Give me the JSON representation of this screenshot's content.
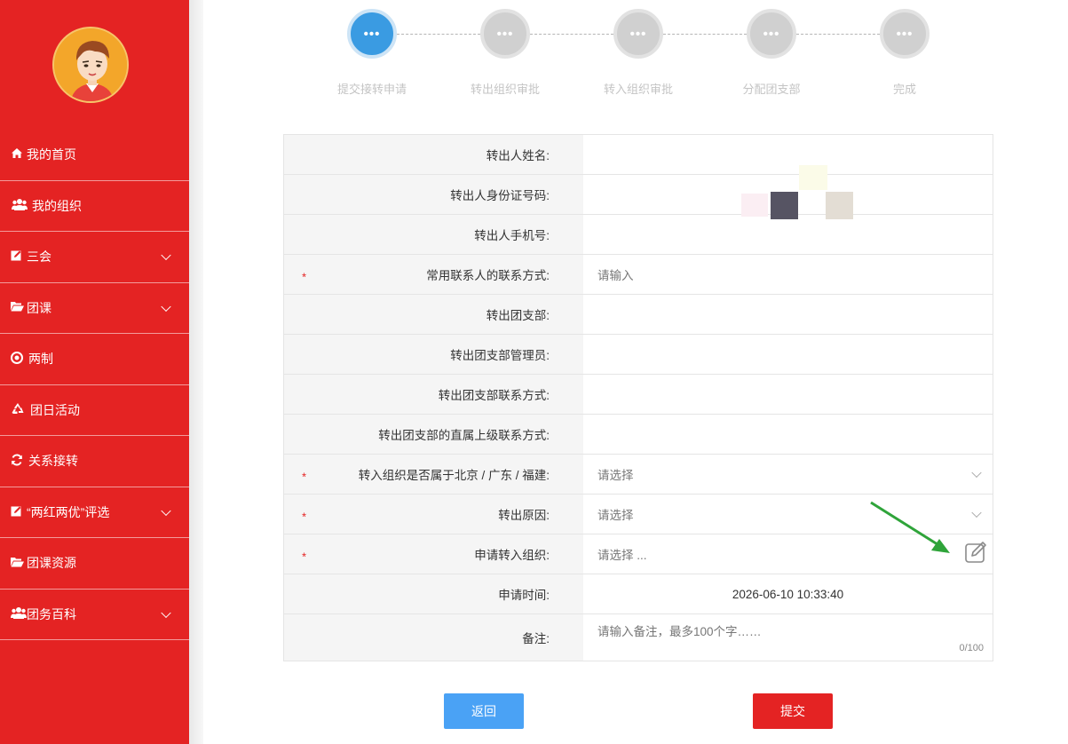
{
  "sidebar": {
    "items": [
      {
        "icon": "home-icon",
        "label": "我的首页",
        "has_submenu": false
      },
      {
        "icon": "users-icon",
        "label": "我的组织",
        "has_submenu": false
      },
      {
        "icon": "edit-icon",
        "label": "三会",
        "has_submenu": true
      },
      {
        "icon": "folder-icon",
        "label": "团课",
        "has_submenu": true
      },
      {
        "icon": "target-icon",
        "label": "两制",
        "has_submenu": false
      },
      {
        "icon": "recycle-icon",
        "label": "团日活动",
        "has_submenu": false
      },
      {
        "icon": "refresh-icon",
        "label": "关系接转",
        "has_submenu": false
      },
      {
        "icon": "edit-icon",
        "label": "“两红两优”评选",
        "has_submenu": true
      },
      {
        "icon": "folder-icon",
        "label": "团课资源",
        "has_submenu": false
      },
      {
        "icon": "users-icon",
        "label": "团务百科",
        "has_submenu": true
      }
    ]
  },
  "steps": [
    {
      "label": "提交接转申请",
      "dots": "•••",
      "active": true
    },
    {
      "label": "转出组织审批",
      "dots": "•••",
      "active": false
    },
    {
      "label": "转入组织审批",
      "dots": "•••",
      "active": false
    },
    {
      "label": "分配团支部",
      "dots": "•••",
      "active": false
    },
    {
      "label": "完成",
      "dots": "•••",
      "active": false
    }
  ],
  "form": {
    "rows": [
      {
        "label": "转出人姓名:",
        "required": false,
        "value": "",
        "kind": "text"
      },
      {
        "label": "转出人身份证号码:",
        "required": false,
        "value": "",
        "kind": "text"
      },
      {
        "label": "转出人手机号:",
        "required": false,
        "value": "",
        "kind": "text"
      },
      {
        "label": "常用联系人的联系方式:",
        "required": true,
        "value": "请输入",
        "kind": "input"
      },
      {
        "label": "转出团支部:",
        "required": false,
        "value": "",
        "kind": "text"
      },
      {
        "label": "转出团支部管理员:",
        "required": false,
        "value": "",
        "kind": "text"
      },
      {
        "label": "转出团支部联系方式:",
        "required": false,
        "value": "",
        "kind": "text"
      },
      {
        "label": "转出团支部的直属上级联系方式:",
        "required": false,
        "value": "",
        "kind": "text"
      },
      {
        "label": "转入组织是否属于北京 / 广东 / 福建:",
        "required": true,
        "value": "请选择",
        "kind": "select"
      },
      {
        "label": "转出原因:",
        "required": true,
        "value": "请选择",
        "kind": "select"
      },
      {
        "label": "申请转入组织:",
        "required": true,
        "value": "请选择 ...",
        "kind": "picker"
      },
      {
        "label": "申请时间:",
        "required": false,
        "value": "2026-06-10 10:33:40",
        "kind": "center"
      }
    ],
    "remark": {
      "label": "备注:",
      "placeholder": "请输入备注，最多100个字……",
      "counter": "0/100"
    },
    "required_mark": "*"
  },
  "buttons": {
    "back": "返回",
    "submit": "提交"
  },
  "colors": {
    "primary_red": "#e42323",
    "step_active": "#3a9be2",
    "back_button": "#4aa2f5",
    "arrow": "#2fa43a"
  }
}
